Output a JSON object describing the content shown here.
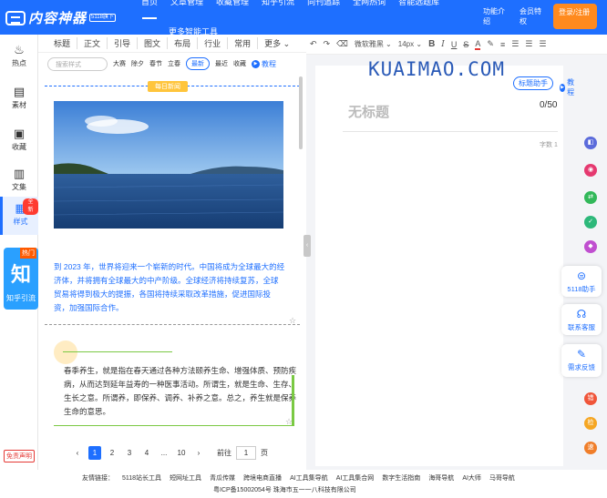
{
  "nav": {
    "brand": "内容神器",
    "brand_badge": "5118旗下",
    "links": [
      "首页",
      "文章管理",
      "收藏管理",
      "知乎引流",
      "同刊追踪",
      "全网热词",
      "智能选题库"
    ],
    "more_tools": "更多智能工具",
    "feature_intro": "功能介绍",
    "vip": "会员特权",
    "login": "登录/注册"
  },
  "sidebar": {
    "items": [
      {
        "label": "热点",
        "icon": "fire-icon"
      },
      {
        "label": "素材",
        "icon": "material-icon"
      },
      {
        "label": "收藏",
        "icon": "favorite-icon"
      },
      {
        "label": "文集",
        "icon": "collection-icon"
      },
      {
        "label": "样式",
        "icon": "style-icon"
      }
    ],
    "new_tag": "全新",
    "ad_hot": "热门",
    "ad_char": "知",
    "ad_text": "知乎引流",
    "disclaimer": "免责声明"
  },
  "panel": {
    "tabs": [
      "标题",
      "正文",
      "引导",
      "图文",
      "布局",
      "行业",
      "常用",
      "更多"
    ],
    "search_placeholder": "搜索样式",
    "subtabs": [
      "大赛",
      "除夕",
      "春节",
      "立春",
      "最新",
      "最近",
      "收藏"
    ],
    "tutorial": "教程",
    "daily_label": "每日新闻",
    "card1_text": "到 2023 年，世界将迎来一个崭新的时代。中国将成为全球最大的经济体，并将拥有全球最大的中产阶级。全球经济将持续复苏，全球贸易将得到极大的提振，各国将持续采取改革措施，促进国际投资，加强国际合作。",
    "card2_text": "春季养生，就是指在春天通过各种方法颐养生命、增强体质、预防疾病，从而达到延年益寿的一种医事活动。所谓生，就是生命、生存、生长之意。所谓养，即保养、调养、补养之意。总之，养生就是保养生命的意思。",
    "pager": {
      "pages": [
        "1",
        "2",
        "3",
        "4",
        "...",
        "10"
      ],
      "goto_label": "前往",
      "goto_value": "1",
      "page_unit": "页"
    }
  },
  "editor": {
    "font": "微软雅黑",
    "size": "14px",
    "watermark": "KUAIMAO.COM",
    "helper": "标题助手",
    "tutorial": "教程",
    "title_placeholder": "无标题",
    "title_count": "0/50",
    "word_count": "字数 1"
  },
  "right_tools": {
    "assistant": "5118助手",
    "service": "联系客服",
    "feedback": "需求反馈",
    "err": "错",
    "check": "检",
    "fast": "速"
  },
  "footer": {
    "links": [
      "友情链接：",
      "5118站长工具",
      "短网址工具",
      "青瓜传媒",
      "跨境电商直播",
      "AI工具集导航",
      "AI工具集合网",
      "数字生活指南",
      "海哥导航",
      "AI大师",
      "马哥导航"
    ],
    "icp": "粤ICP备15002054号 珠海市五一一八科技有限公司"
  },
  "colors": {
    "brand": "#1e6fff",
    "login": "#ff8a1e",
    "daily": "#ffc53d",
    "accent_green": "#7ac943"
  }
}
